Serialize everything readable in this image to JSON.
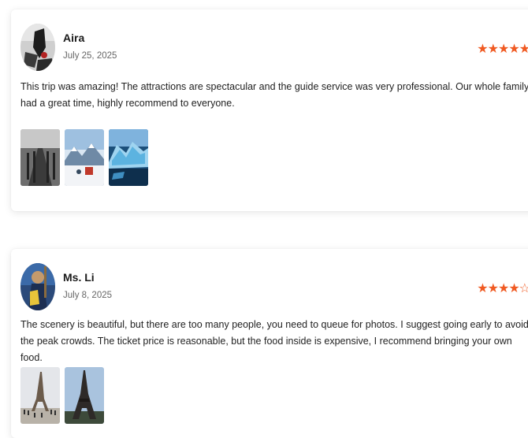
{
  "reviews": [
    {
      "name": "Aira",
      "date": "July 25, 2025",
      "rating": 5,
      "max_rating": 5,
      "text": "This trip was amazing! The attractions are spectacular and the guide service was very professional. Our whole family had a great time, highly recommend to everyone.",
      "photos": [
        "pier-photo",
        "snowy-mountain-photo",
        "glacier-ice-photo"
      ]
    },
    {
      "name": "Ms. Li",
      "date": "July 8, 2025",
      "rating": 4,
      "max_rating": 5,
      "text": "The scenery is beautiful, but there are too many people, you need to queue for photos. I suggest going early to avoid the peak crowds. The ticket price is reasonable, but the food inside is expensive, I recommend bringing your own food.",
      "photos": [
        "eiffel-tower-plaza-photo",
        "eiffel-tower-photo"
      ]
    }
  ],
  "colors": {
    "star": "#f05a22",
    "text": "#222222",
    "date": "#666666",
    "card_bg": "#ffffff"
  }
}
